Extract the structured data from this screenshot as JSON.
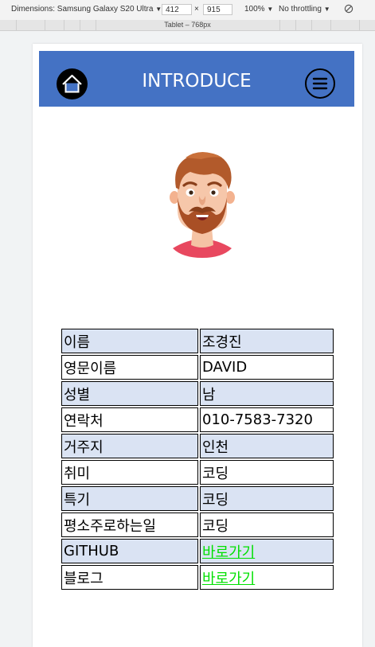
{
  "devtools": {
    "dimensions_label": "Dimensions: Samsung Galaxy S20 Ultra",
    "width": "412",
    "times": "×",
    "height": "915",
    "zoom": "100%",
    "throttling": "No throttling",
    "dropdown_glyph": "▼",
    "ruler_label": "Tablet – 768px"
  },
  "header": {
    "title": "INTRODUCE"
  },
  "profile": {
    "rows": [
      {
        "key": "이름",
        "value": "조경진"
      },
      {
        "key": "영문이름",
        "value": "DAVID"
      },
      {
        "key": "성별",
        "value": "남"
      },
      {
        "key": "연락처",
        "value": "010-7583-7320"
      },
      {
        "key": "거주지",
        "value": "인천"
      },
      {
        "key": "취미",
        "value": "코딩"
      },
      {
        "key": "특기",
        "value": "코딩"
      },
      {
        "key": "평소주로하는일",
        "value": "코딩"
      },
      {
        "key": "GITHUB",
        "link": "바로가기"
      },
      {
        "key": "블로그",
        "link": "바로가기"
      }
    ]
  },
  "colors": {
    "header_bg": "#4472c4",
    "row_shade": "#dae3f3",
    "link": "#00e000"
  }
}
